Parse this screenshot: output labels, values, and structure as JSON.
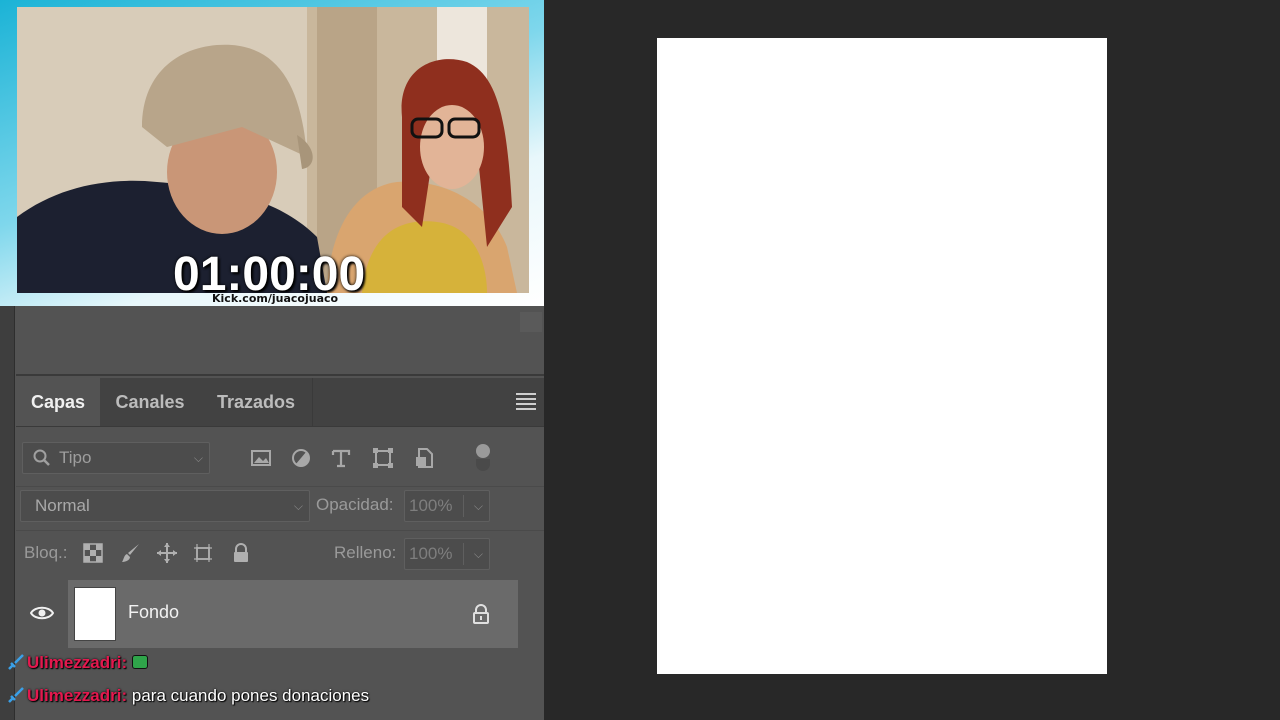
{
  "webcam": {
    "timer": "01:00:00",
    "stream_url": "Kick.com/juacojuaco"
  },
  "layers_panel": {
    "tabs": [
      {
        "label": "Capas",
        "active": true
      },
      {
        "label": "Canales",
        "active": false
      },
      {
        "label": "Trazados",
        "active": false
      }
    ],
    "filter": {
      "placeholder": "Tipo"
    },
    "blend_mode": "Normal",
    "opacity_label": "Opacidad:",
    "opacity_value": "100%",
    "lock_label": "Bloq.:",
    "fill_label": "Relleno:",
    "fill_value": "100%",
    "layers": [
      {
        "name": "Fondo",
        "visible": true,
        "locked": true
      }
    ]
  },
  "chat": [
    {
      "user": "Ulimezzadri:",
      "message": "",
      "emote": "green-emote"
    },
    {
      "user": "Ulimezzadri:",
      "message": "para cuando pones donaciones"
    }
  ],
  "colors": {
    "panel_bg": "#535353",
    "workspace_bg": "#282828",
    "canvas": "#ffffff",
    "chat_username": "#e4184e",
    "webcam_border": "#1bb3d6"
  }
}
